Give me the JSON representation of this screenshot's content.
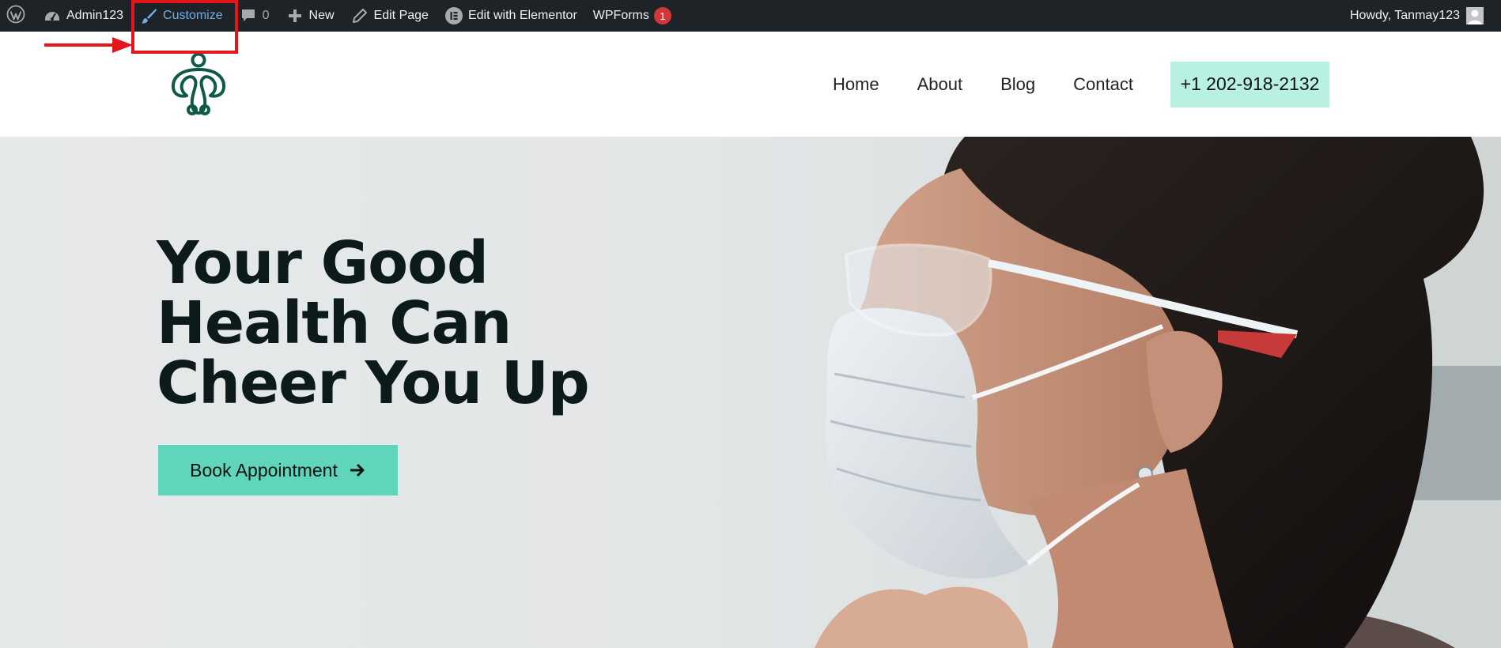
{
  "admin_bar": {
    "site_name": "Admin123",
    "customize": "Customize",
    "comments_count": "0",
    "new": "New",
    "edit_page": "Edit Page",
    "edit_with_elementor": "Edit with Elementor",
    "wpforms": "WPForms",
    "wpforms_badge": "1",
    "greeting": "Howdy, Tanmay123"
  },
  "header": {
    "nav": [
      "Home",
      "About",
      "Blog",
      "Contact"
    ],
    "phone": "+1 202-918-2132"
  },
  "hero": {
    "title_lines": [
      "Your Good",
      "Health Can",
      "Cheer You Up"
    ],
    "cta_label": "Book Appointment"
  },
  "icons": {
    "wordpress": "wordpress-logo-icon",
    "dashboard": "dashboard-gauge-icon",
    "customize": "paintbrush-icon",
    "comments": "comment-bubble-icon",
    "new": "plus-icon",
    "edit": "pencil-icon",
    "elementor": "elementor-icon",
    "avatar": "user-avatar-icon",
    "cta_arrow": "arrow-right-icon"
  },
  "colors": {
    "admin_bar_bg": "#1d2327",
    "customize_link": "#72aee6",
    "annotation_red": "#e3161b",
    "phone_button_bg": "#b8f0e2",
    "cta_bg": "#5fd6bb",
    "brand_green": "#0f5a46",
    "hero_title": "#0c1a1a"
  }
}
